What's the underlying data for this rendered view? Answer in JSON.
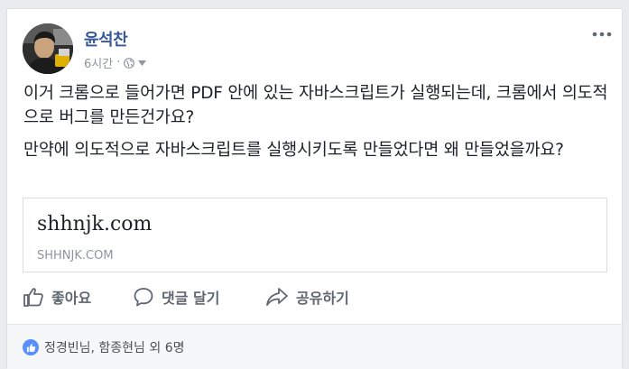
{
  "post": {
    "author": "윤석찬",
    "time": "6시간",
    "separator": "·",
    "paragraphs": [
      "이거 크롬으로 들어가면 PDF 안에 있는 자바스크립트가 실행되는데, 크롬에서 의도적으로 버그를 만든건가요?",
      "만약에 의도적으로 자바스크립트를 실행시키도록 만들었다면 왜 만들었을까요?"
    ]
  },
  "link_preview": {
    "title": "shhnjk.com",
    "domain": "SHHNJK.COM"
  },
  "actions": {
    "like": "좋아요",
    "comment": "댓글 달기",
    "share": "공유하기"
  },
  "reactions": {
    "text": "정경빈님, 함종현님 외 6명"
  },
  "colors": {
    "author": "#365899",
    "like_badge": "#5890ff",
    "action_text": "#606770",
    "background": "#e9ebee"
  },
  "icons": [
    "avatar-photo",
    "globe-icon",
    "chevron-down-icon",
    "more-options-icon",
    "thumbs-up-icon",
    "comment-icon",
    "share-icon",
    "like-reaction-icon"
  ]
}
